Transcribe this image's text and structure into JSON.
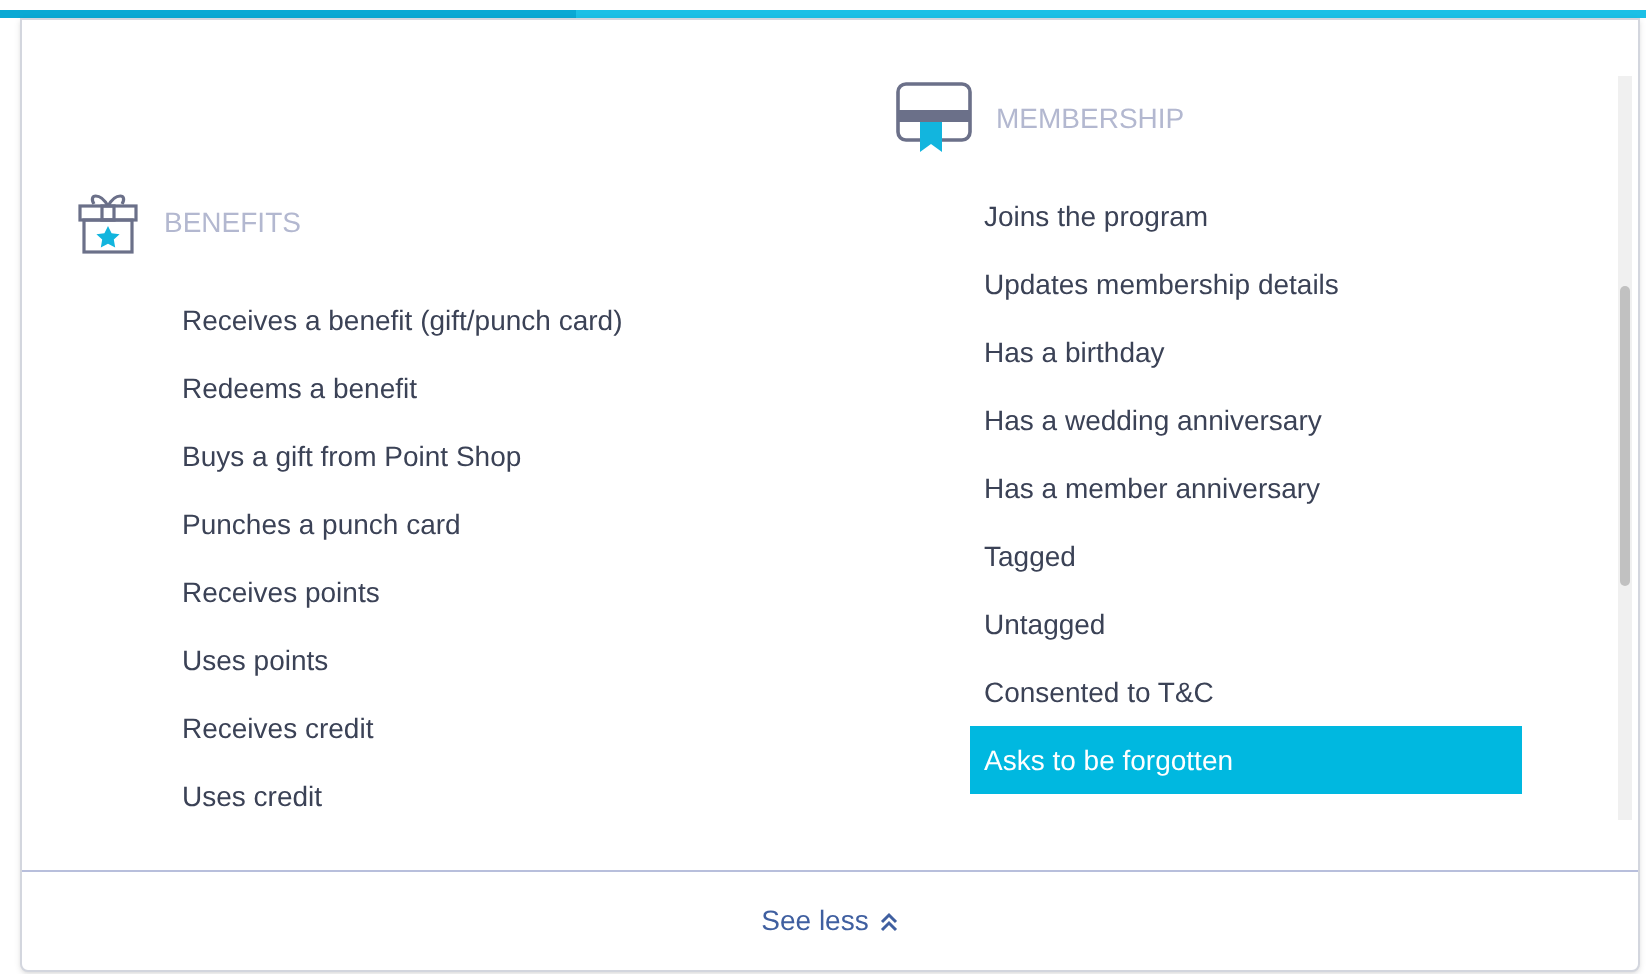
{
  "progress": {
    "level": 0.35
  },
  "sections": [
    {
      "kind": "gift",
      "title": "BENEFITS",
      "items": [
        {
          "label": "Receives a benefit (gift/punch card)",
          "selected": false
        },
        {
          "label": "Redeems a benefit",
          "selected": false
        },
        {
          "label": "Buys a gift from Point Shop",
          "selected": false
        },
        {
          "label": "Punches a punch card",
          "selected": false
        },
        {
          "label": "Receives points",
          "selected": false
        },
        {
          "label": "Uses points",
          "selected": false
        },
        {
          "label": "Receives credit",
          "selected": false
        },
        {
          "label": "Uses credit",
          "selected": false
        }
      ]
    },
    {
      "kind": "card",
      "title": "MEMBERSHIP",
      "items": [
        {
          "label": "Joins the program",
          "selected": false
        },
        {
          "label": "Updates membership details",
          "selected": false
        },
        {
          "label": "Has a birthday",
          "selected": false
        },
        {
          "label": "Has a wedding anniversary",
          "selected": false
        },
        {
          "label": "Has a member anniversary",
          "selected": false
        },
        {
          "label": "Tagged",
          "selected": false
        },
        {
          "label": "Untagged",
          "selected": false
        },
        {
          "label": "Consented to T&C",
          "selected": false
        },
        {
          "label": "Asks to be forgotten",
          "selected": true
        }
      ]
    }
  ],
  "footer": {
    "label": "See less"
  }
}
